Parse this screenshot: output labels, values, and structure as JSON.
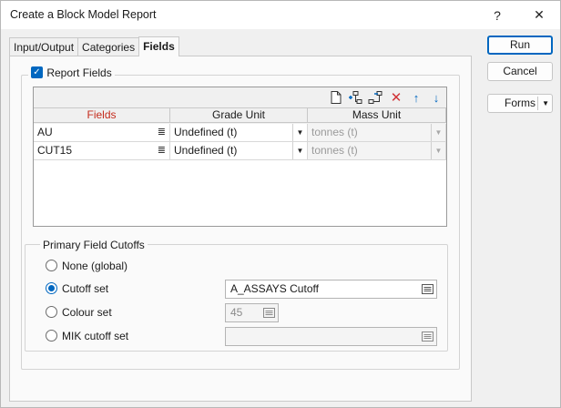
{
  "window": {
    "title": "Create a Block Model Report",
    "help_label": "?",
    "close_label": "✕"
  },
  "tabs": [
    {
      "label": "Input/Output",
      "active": false
    },
    {
      "label": "Categories",
      "active": false
    },
    {
      "label": "Fields",
      "active": true
    }
  ],
  "report_fields": {
    "label": "Report Fields",
    "checked": true,
    "toolbar": [
      "new-icon",
      "insert-icon",
      "append-icon",
      "delete-icon",
      "move-up-icon",
      "move-down-icon"
    ],
    "columns": [
      "Fields",
      "Grade Unit",
      "Mass Unit"
    ],
    "rows": [
      {
        "field": "AU",
        "grade_unit": "Undefined (t)",
        "mass_unit": "tonnes (t)"
      },
      {
        "field": "CUT15",
        "grade_unit": "Undefined (t)",
        "mass_unit": "tonnes (t)"
      }
    ]
  },
  "cutoffs": {
    "legend": "Primary Field Cutoffs",
    "options": [
      {
        "label": "None (global)",
        "selected": false
      },
      {
        "label": "Cutoff set",
        "selected": true,
        "value": "A_ASSAYS Cutoff"
      },
      {
        "label": "Colour set",
        "selected": false,
        "value": "45"
      },
      {
        "label": "MIK cutoff set",
        "selected": false,
        "value": ""
      }
    ]
  },
  "buttons": {
    "run": "Run",
    "cancel": "Cancel",
    "forms": "Forms"
  },
  "colors": {
    "accent": "#0067c0",
    "delete": "#d13438",
    "header_text_fields": "#c42b1c"
  }
}
